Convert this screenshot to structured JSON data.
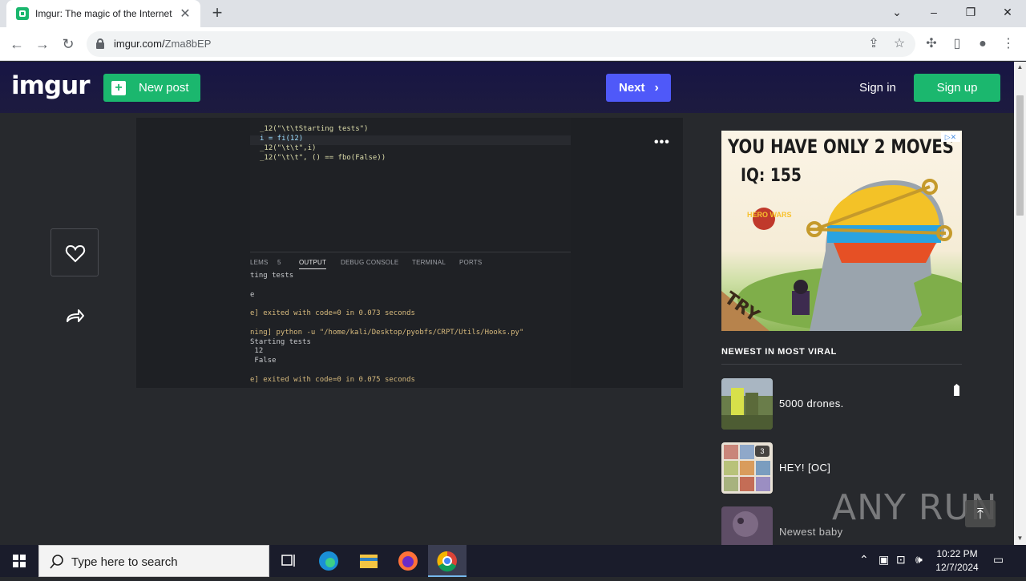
{
  "browser": {
    "tab_title": "Imgur: The magic of the Internet",
    "url_host": "imgur.com/",
    "url_path": "Zma8bEP"
  },
  "header": {
    "logo": "imgur",
    "new_post_label": "New post",
    "next_label": "Next",
    "sign_in_label": "Sign in",
    "sign_up_label": "Sign up"
  },
  "code_editor": {
    "lines": [
      "_12(\"\\t\\tStarting tests\")",
      "i = fi(12)",
      "_12(\"\\t\\t\",i)",
      "_12(\"\\t\\t\", () == fbo(False))"
    ]
  },
  "output_panel": {
    "tabs": [
      "LEMS",
      "5",
      "OUTPUT",
      "DEBUG CONSOLE",
      "TERMINAL",
      "PORTS"
    ],
    "active_tab": "OUTPUT",
    "lines": [
      "ting tests",
      "",
      "e",
      "",
      "e] exited with code=0 in 0.073 seconds",
      "",
      "ning] python -u \"/home/kali/Desktop/pyobfs/CRPT/Utils/Hooks.py\"",
      "Starting tests",
      " 12",
      " False",
      "",
      "e] exited with code=0 in 0.075 seconds"
    ]
  },
  "ad": {
    "headline": "YOU HAVE ONLY 2 MOVES",
    "iq": "IQ: 155",
    "brand": "HERO WARS",
    "cta": "TRY"
  },
  "sidebar": {
    "section_title": "NEWEST IN MOST VIRAL",
    "posts": [
      {
        "title": "5000 drones.",
        "badge": ""
      },
      {
        "title": "HEY! [OC]",
        "badge": "3"
      },
      {
        "title": "Newest baby",
        "badge": ""
      }
    ]
  },
  "watermark": "ANY RUN",
  "taskbar": {
    "search_placeholder": "Type here to search",
    "time": "10:22 PM",
    "date": "12/7/2024"
  },
  "colors": {
    "imgur_green": "#1bb76e",
    "next_blue": "#4f59f9",
    "header_navy": "#171544",
    "page_bg": "#27292d"
  }
}
